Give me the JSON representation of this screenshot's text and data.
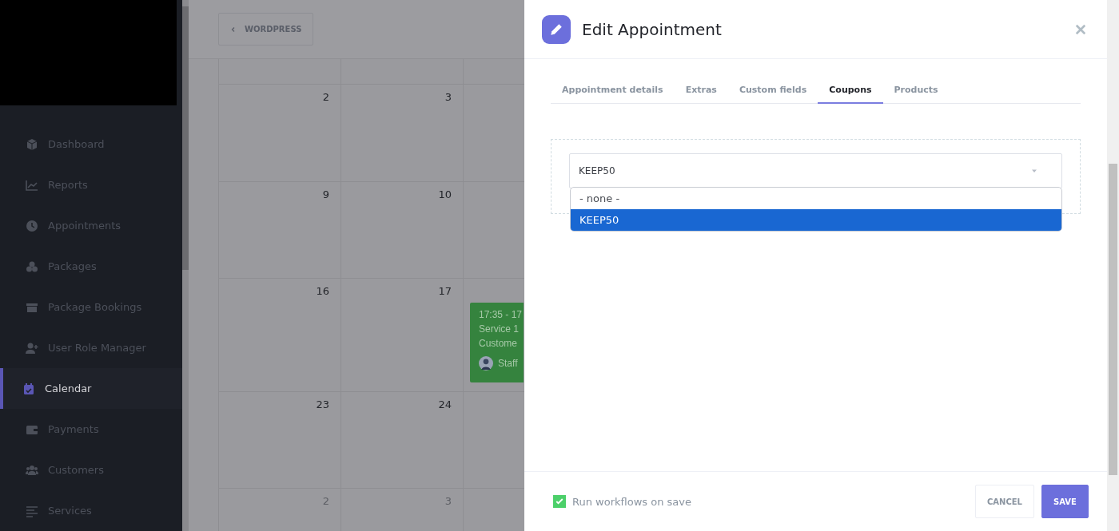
{
  "sidebar": {
    "items": [
      {
        "label": "Dashboard",
        "selected": false
      },
      {
        "label": "Reports",
        "selected": false
      },
      {
        "label": "Appointments",
        "selected": false
      },
      {
        "label": "Packages",
        "selected": false
      },
      {
        "label": "Package Bookings",
        "selected": false
      },
      {
        "label": "User Role Manager",
        "selected": false
      },
      {
        "label": "Calendar",
        "selected": true
      },
      {
        "label": "Payments",
        "selected": false
      },
      {
        "label": "Customers",
        "selected": false
      },
      {
        "label": "Services",
        "selected": false
      }
    ]
  },
  "back_button": {
    "label": "WORDPRESS"
  },
  "calendar": {
    "weeks": [
      {
        "days": [
          {
            "day": "2",
            "muted": false
          },
          {
            "day": "3",
            "muted": false
          }
        ]
      },
      {
        "days": [
          {
            "day": "9",
            "muted": false
          },
          {
            "day": "10",
            "muted": false
          }
        ]
      },
      {
        "days": [
          {
            "day": "16",
            "muted": false
          },
          {
            "day": "17",
            "muted": false
          }
        ],
        "event": {
          "time": "17:35 - 17",
          "service": "Service 1",
          "customer": "Custome",
          "staff": "Staff"
        }
      },
      {
        "days": [
          {
            "day": "23",
            "muted": false
          },
          {
            "day": "24",
            "muted": false
          }
        ]
      },
      {
        "days": [
          {
            "day": "2",
            "muted": true
          },
          {
            "day": "3",
            "muted": true
          }
        ]
      }
    ]
  },
  "modal": {
    "title": "Edit Appointment",
    "tabs": [
      {
        "label": "Appointment details",
        "selected": false
      },
      {
        "label": "Extras",
        "selected": false
      },
      {
        "label": "Custom fields",
        "selected": false
      },
      {
        "label": "Coupons",
        "selected": true
      },
      {
        "label": "Products",
        "selected": false
      }
    ],
    "coupon_select": {
      "value": "KEEP50",
      "options": [
        {
          "label": "- none -",
          "selected": false
        },
        {
          "label": "KEEP50",
          "selected": true
        }
      ]
    },
    "run_workflows": {
      "label": "Run workflows on save",
      "checked": true
    },
    "buttons": [
      {
        "label": "CANCEL",
        "kind": "secondary"
      },
      {
        "label": "SAVE",
        "kind": "primary"
      }
    ]
  }
}
